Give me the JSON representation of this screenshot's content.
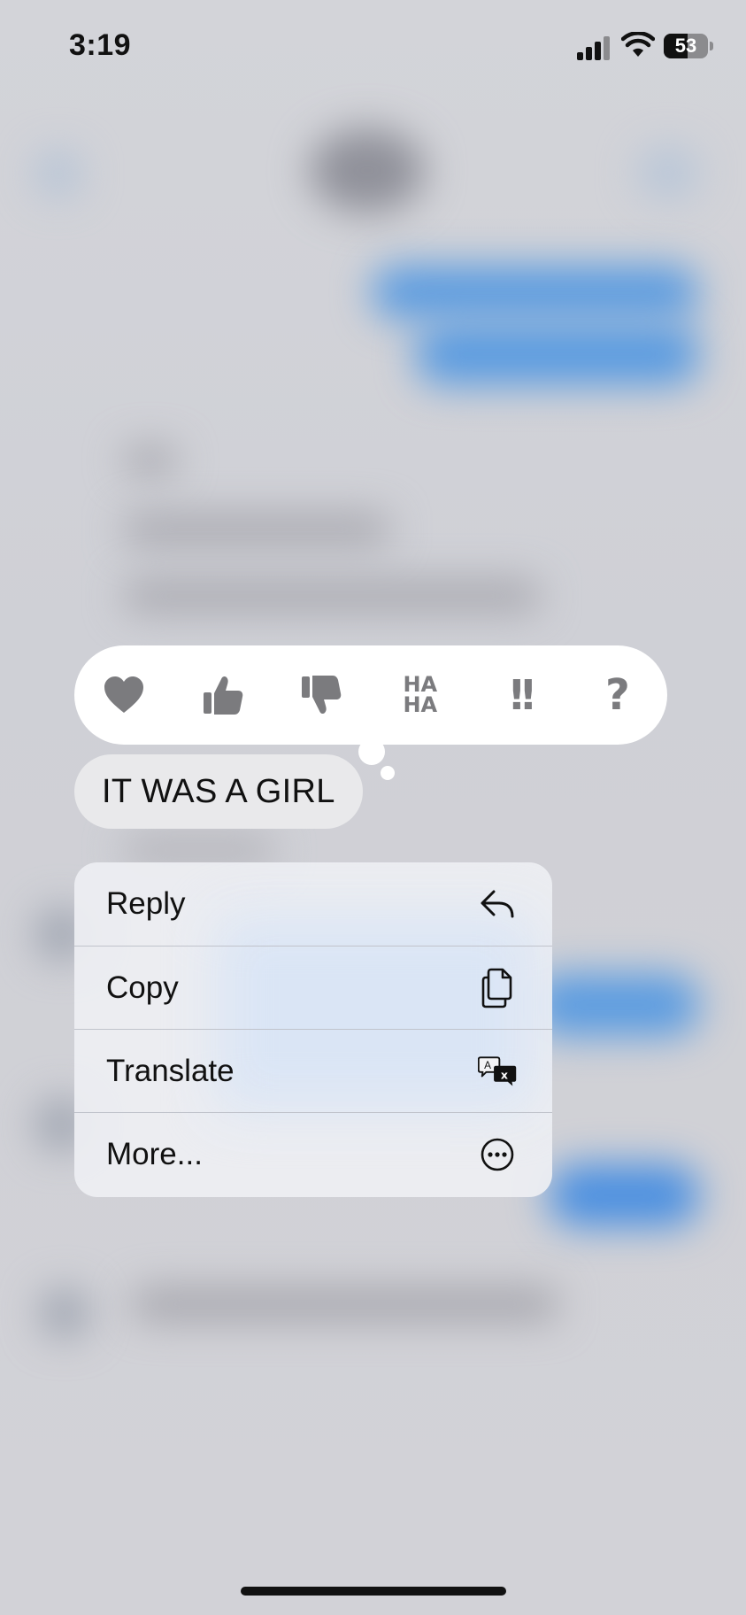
{
  "status_bar": {
    "time": "3:19",
    "battery": "53",
    "battery_level": 0.53
  },
  "reactions": [
    {
      "name": "heart",
      "icon": "heart-icon"
    },
    {
      "name": "thumbs-up",
      "icon": "thumbs-up-icon"
    },
    {
      "name": "thumbs-down",
      "icon": "thumbs-down-icon"
    },
    {
      "name": "haha",
      "icon": "haha-icon",
      "line1": "HA",
      "line2": "HA"
    },
    {
      "name": "emphasize",
      "icon": "double-exclamation-icon",
      "label": "!!"
    },
    {
      "name": "question",
      "icon": "question-icon",
      "label": "?"
    }
  ],
  "message": {
    "text": "IT WAS A GIRL"
  },
  "context_menu": {
    "items": [
      {
        "label": "Reply",
        "icon": "reply-arrow-icon"
      },
      {
        "label": "Copy",
        "icon": "copy-icon"
      },
      {
        "label": "Translate",
        "icon": "translate-icon"
      },
      {
        "label": "More...",
        "icon": "more-ellipsis-icon"
      }
    ]
  },
  "colors": {
    "reaction_icon": "#7b7b7e",
    "bubble_bg": "#e9e9eb",
    "menu_bg": "#eeeff3",
    "blurred_blue": "#5a9be0"
  }
}
